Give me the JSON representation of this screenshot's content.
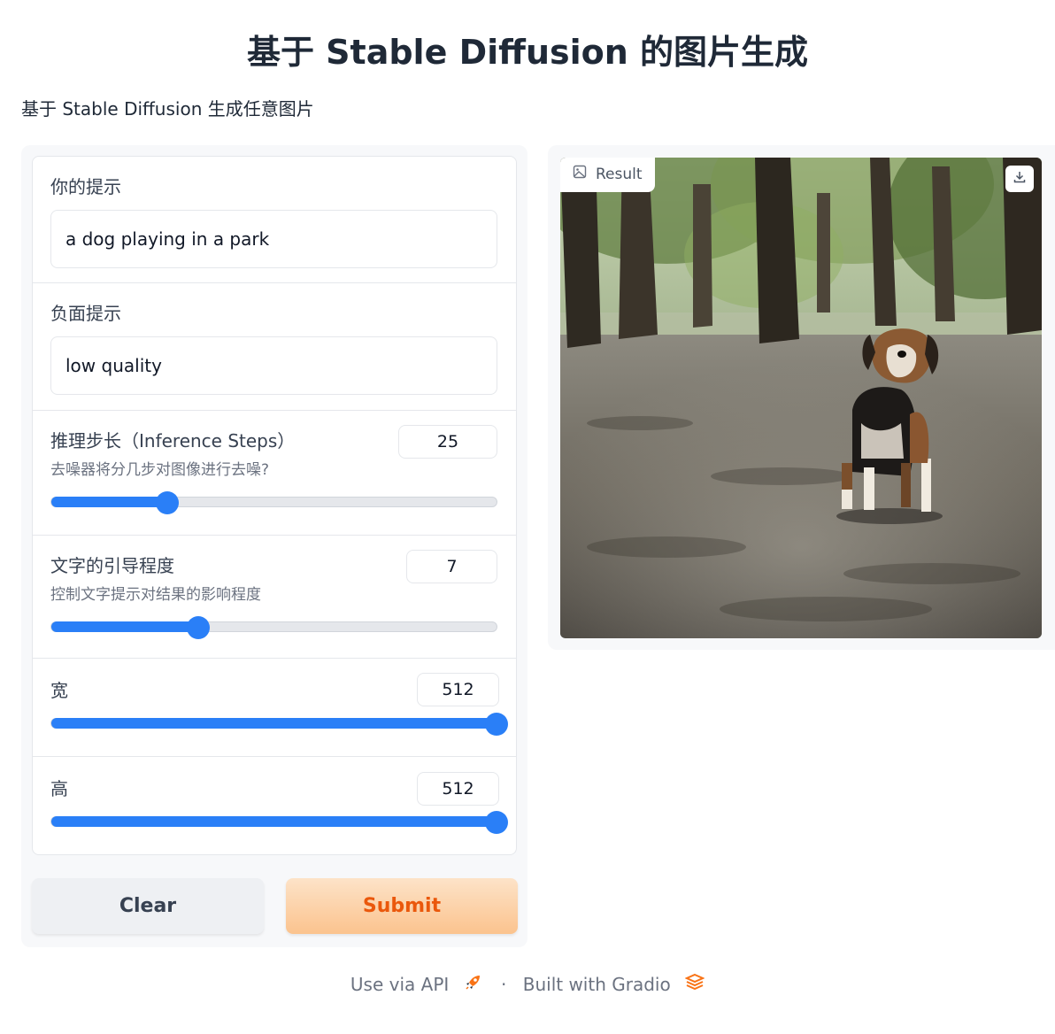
{
  "header": {
    "title": "基于 Stable Diffusion 的图片生成",
    "description": "基于 Stable Diffusion 生成任意图片"
  },
  "inputs": {
    "prompt": {
      "label": "你的提示",
      "value": "a dog playing in a park"
    },
    "negative_prompt": {
      "label": "负面提示",
      "value": "low quality"
    },
    "steps": {
      "label": "推理步长（Inference Steps）",
      "info": "去噪器将分几步对图像进行去噪?",
      "value": "25",
      "fraction": 0.26
    },
    "guidance": {
      "label": "文字的引导程度",
      "info": "控制文字提示对结果的影响程度",
      "value": "7",
      "fraction": 0.33
    },
    "width": {
      "label": "宽",
      "value": "512",
      "fraction": 1.0
    },
    "height": {
      "label": "高",
      "value": "512",
      "fraction": 1.0
    }
  },
  "buttons": {
    "clear": "Clear",
    "submit": "Submit"
  },
  "output": {
    "label": "Result",
    "image_icon": "image-icon",
    "download_icon": "download-icon"
  },
  "footer": {
    "api": "Use via API",
    "separator": "·",
    "built": "Built with Gradio"
  },
  "colors": {
    "accent": "#2a7ff7",
    "submit_text": "#ea580c",
    "gradio_orange": "#f97316"
  }
}
